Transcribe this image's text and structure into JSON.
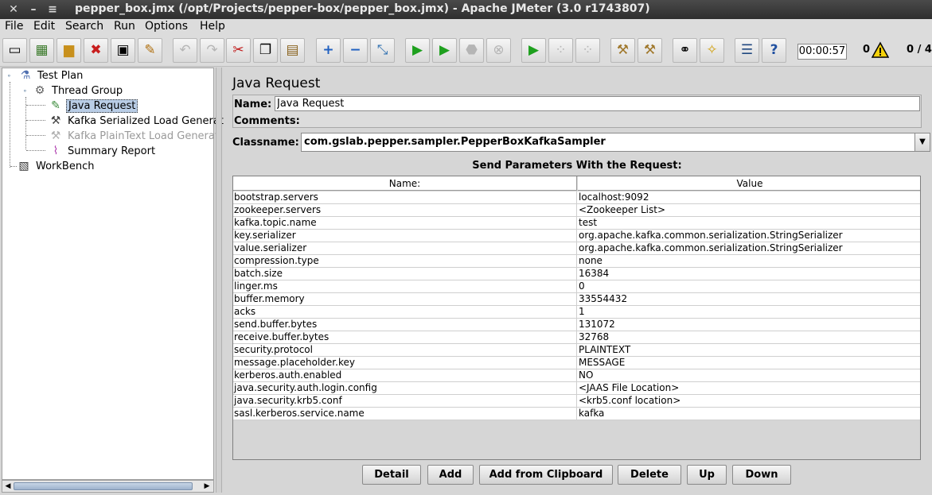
{
  "window": {
    "title": "pepper_box.jmx (/opt/Projects/pepper-box/pepper_box.jmx) - Apache JMeter (3.0 r1743807)"
  },
  "menu": [
    "File",
    "Edit",
    "Search",
    "Run",
    "Options",
    "Help"
  ],
  "toolbar": {
    "timer": "00:00:57",
    "warning_count": "0",
    "threads": "0 / 4"
  },
  "tree": {
    "test_plan": "Test Plan",
    "thread_group": "Thread Group",
    "java_request": "Java Request",
    "kafka_serialized": "Kafka Serialized Load Generat",
    "kafka_plaintext": "Kafka PlainText Load Generat",
    "summary_report": "Summary Report",
    "workbench": "WorkBench"
  },
  "panel": {
    "title": "Java Request",
    "name_label": "Name:",
    "name_value": "Java Request",
    "comments_label": "Comments:",
    "classname_label": "Classname:",
    "classname_value": "com.gslab.pepper.sampler.PepperBoxKafkaSampler",
    "params_title": "Send Parameters With the Request:",
    "columns": [
      "Name:",
      "Value"
    ],
    "params": [
      {
        "name": "bootstrap.servers",
        "value": "localhost:9092"
      },
      {
        "name": "zookeeper.servers",
        "value": "<Zookeeper List>"
      },
      {
        "name": "kafka.topic.name",
        "value": "test"
      },
      {
        "name": "key.serializer",
        "value": "org.apache.kafka.common.serialization.StringSerializer"
      },
      {
        "name": "value.serializer",
        "value": "org.apache.kafka.common.serialization.StringSerializer"
      },
      {
        "name": "compression.type",
        "value": "none"
      },
      {
        "name": "batch.size",
        "value": "16384"
      },
      {
        "name": "linger.ms",
        "value": "0"
      },
      {
        "name": "buffer.memory",
        "value": "33554432"
      },
      {
        "name": "acks",
        "value": "1"
      },
      {
        "name": "send.buffer.bytes",
        "value": "131072"
      },
      {
        "name": "receive.buffer.bytes",
        "value": "32768"
      },
      {
        "name": "security.protocol",
        "value": "PLAINTEXT"
      },
      {
        "name": "message.placeholder.key",
        "value": "MESSAGE"
      },
      {
        "name": "kerberos.auth.enabled",
        "value": "NO"
      },
      {
        "name": "java.security.auth.login.config",
        "value": "<JAAS File Location>"
      },
      {
        "name": "java.security.krb5.conf",
        "value": "<krb5.conf location>"
      },
      {
        "name": "sasl.kerberos.service.name",
        "value": "kafka"
      }
    ],
    "buttons": [
      "Detail",
      "Add",
      "Add from Clipboard",
      "Delete",
      "Up",
      "Down"
    ]
  }
}
